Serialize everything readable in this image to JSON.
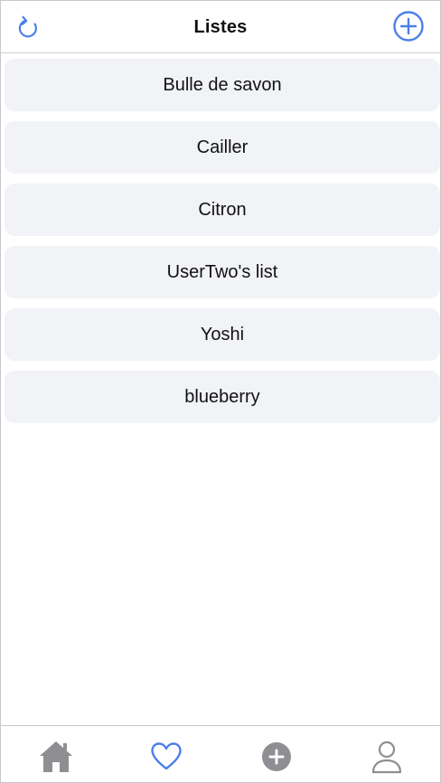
{
  "header": {
    "title": "Listes",
    "refresh_icon": "refresh-icon",
    "add_icon": "plus-circle-icon"
  },
  "lists": [
    {
      "label": "Bulle de savon"
    },
    {
      "label": "Cailler"
    },
    {
      "label": "Citron"
    },
    {
      "label": "UserTwo's list"
    },
    {
      "label": "Yoshi"
    },
    {
      "label": "blueberry"
    }
  ],
  "tabbar": {
    "tabs": [
      {
        "icon": "home-icon",
        "active": false
      },
      {
        "icon": "heart-icon",
        "active": true
      },
      {
        "icon": "plus-circle-filled-icon",
        "active": false
      },
      {
        "icon": "user-icon",
        "active": false
      }
    ]
  },
  "colors": {
    "accent": "#4a80e8",
    "inactive_icon": "#8e8e93",
    "item_background": "#f2f3f7"
  }
}
